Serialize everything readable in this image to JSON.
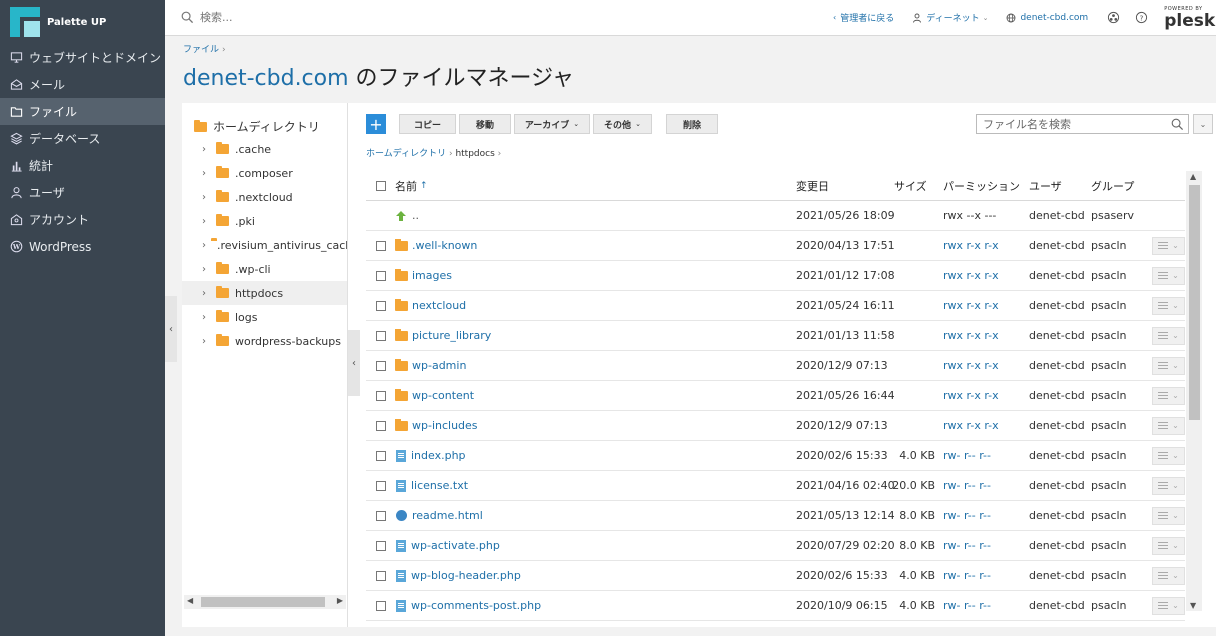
{
  "brand": {
    "name": "Palette UP"
  },
  "nav": [
    {
      "label": "ウェブサイトとドメイン",
      "icon": "monitor-icon",
      "active": false
    },
    {
      "label": "メール",
      "icon": "mail-icon",
      "active": false
    },
    {
      "label": "ファイル",
      "icon": "folder-icon",
      "active": true
    },
    {
      "label": "データベース",
      "icon": "database-icon",
      "active": false
    },
    {
      "label": "統計",
      "icon": "bar-chart-icon",
      "active": false
    },
    {
      "label": "ユーザ",
      "icon": "user-icon",
      "active": false
    },
    {
      "label": "アカウント",
      "icon": "account-icon",
      "active": false
    },
    {
      "label": "WordPress",
      "icon": "wordpress-icon",
      "active": false
    }
  ],
  "topbar": {
    "search_placeholder": "検索...",
    "back_to_admin": "管理者に戻る",
    "user_menu": "ディーネット",
    "domain_link": "denet-cbd.com",
    "plesk_powered": "POWERED BY",
    "plesk_name": "plesk"
  },
  "header": {
    "breadcrumb": "ファイル",
    "title_domain": "denet-cbd.com",
    "title_suffix": " のファイルマネージャ"
  },
  "tree": {
    "root": "ホームディレクトリ",
    "items": [
      ".cache",
      ".composer",
      ".nextcloud",
      ".pki",
      ".revisium_antivirus_cache",
      ".wp-cli",
      "httpdocs",
      "logs",
      "wordpress-backups"
    ],
    "selected": "httpdocs"
  },
  "toolbar": {
    "add": "+",
    "copy": "コピー",
    "move": "移動",
    "archive": "アーカイブ",
    "other": "その他",
    "delete": "削除",
    "filter_placeholder": "ファイル名を検索"
  },
  "path": {
    "home": "ホームディレクトリ",
    "current": "httpdocs"
  },
  "columns": {
    "name": "名前",
    "sort_arrow": "↑",
    "date": "変更日",
    "size": "サイズ",
    "perm": "パーミッション",
    "user": "ユーザ",
    "group": "グループ"
  },
  "rows": [
    {
      "type": "up",
      "name": "..",
      "date": "2021/05/26 18:09",
      "size": "",
      "perm": "rwx --x ---",
      "user": "denet-cbd",
      "group": "psaserv"
    },
    {
      "type": "folder",
      "name": ".well-known",
      "date": "2020/04/13 17:51",
      "size": "",
      "perm": "rwx r-x r-x",
      "user": "denet-cbd",
      "group": "psacln"
    },
    {
      "type": "folder",
      "name": "images",
      "date": "2021/01/12 17:08",
      "size": "",
      "perm": "rwx r-x r-x",
      "user": "denet-cbd",
      "group": "psacln"
    },
    {
      "type": "folder",
      "name": "nextcloud",
      "date": "2021/05/24 16:11",
      "size": "",
      "perm": "rwx r-x r-x",
      "user": "denet-cbd",
      "group": "psacln"
    },
    {
      "type": "folder",
      "name": "picture_library",
      "date": "2021/01/13 11:58",
      "size": "",
      "perm": "rwx r-x r-x",
      "user": "denet-cbd",
      "group": "psacln"
    },
    {
      "type": "folder",
      "name": "wp-admin",
      "date": "2020/12/9 07:13",
      "size": "",
      "perm": "rwx r-x r-x",
      "user": "denet-cbd",
      "group": "psacln"
    },
    {
      "type": "folder",
      "name": "wp-content",
      "date": "2021/05/26 16:44",
      "size": "",
      "perm": "rwx r-x r-x",
      "user": "denet-cbd",
      "group": "psacln"
    },
    {
      "type": "folder",
      "name": "wp-includes",
      "date": "2020/12/9 07:13",
      "size": "",
      "perm": "rwx r-x r-x",
      "user": "denet-cbd",
      "group": "psacln"
    },
    {
      "type": "file",
      "name": "index.php",
      "date": "2020/02/6 15:33",
      "size": "4.0 KB",
      "perm": "rw- r-- r--",
      "user": "denet-cbd",
      "group": "psacln"
    },
    {
      "type": "file",
      "name": "license.txt",
      "date": "2021/04/16 02:40",
      "size": "20.0 KB",
      "perm": "rw- r-- r--",
      "user": "denet-cbd",
      "group": "psacln"
    },
    {
      "type": "html",
      "name": "readme.html",
      "date": "2021/05/13 12:14",
      "size": "8.0 KB",
      "perm": "rw- r-- r--",
      "user": "denet-cbd",
      "group": "psacln"
    },
    {
      "type": "file",
      "name": "wp-activate.php",
      "date": "2020/07/29 02:20",
      "size": "8.0 KB",
      "perm": "rw- r-- r--",
      "user": "denet-cbd",
      "group": "psacln"
    },
    {
      "type": "file",
      "name": "wp-blog-header.php",
      "date": "2020/02/6 15:33",
      "size": "4.0 KB",
      "perm": "rw- r-- r--",
      "user": "denet-cbd",
      "group": "psacln"
    },
    {
      "type": "file",
      "name": "wp-comments-post.php",
      "date": "2020/10/9 06:15",
      "size": "4.0 KB",
      "perm": "rw- r-- r--",
      "user": "denet-cbd",
      "group": "psacln"
    }
  ],
  "colors": {
    "sidebar": "#3a4550",
    "accent": "#1e6fa8",
    "folder": "#f4a535",
    "primary_button": "#2b8dd9"
  }
}
